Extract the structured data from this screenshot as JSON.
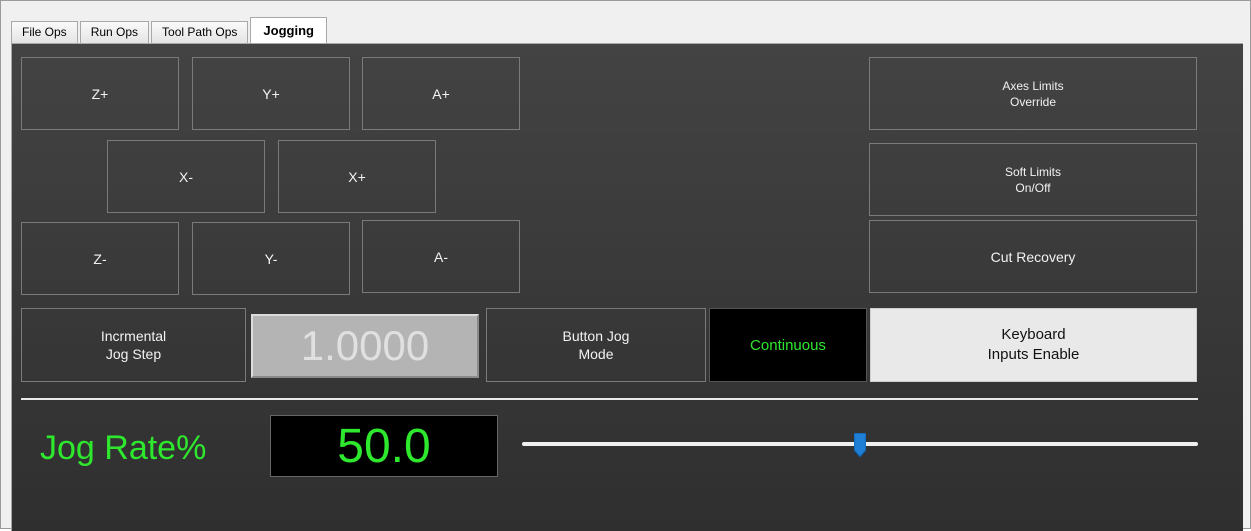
{
  "tabs": [
    "File Ops",
    "Run Ops",
    "Tool Path Ops",
    "Jogging"
  ],
  "active_tab": "Jogging",
  "jog_buttons": {
    "z_plus": "Z+",
    "y_plus": "Y+",
    "a_plus": "A+",
    "x_minus": "X-",
    "x_plus": "X+",
    "z_minus": "Z-",
    "y_minus": "Y-",
    "a_minus": "A-"
  },
  "right_buttons": {
    "axes_limits_override": "Axes Limits\nOverride",
    "soft_limits": "Soft Limits\nOn/Off",
    "cut_recovery": "Cut Recovery",
    "keyboard_inputs": "Keyboard\nInputs Enable"
  },
  "incremental": {
    "label": "Incrmental\nJog Step",
    "value": "1.0000"
  },
  "button_jog_mode": {
    "label": "Button Jog\nMode",
    "mode": "Continuous"
  },
  "jog_rate": {
    "label": "Jog Rate%",
    "value": "50.0",
    "slider_percent": 50
  },
  "colors": {
    "dro_green": "#2ee82e",
    "slider_thumb": "#1e7fd4",
    "panel_bg": "#3a3a3a"
  }
}
